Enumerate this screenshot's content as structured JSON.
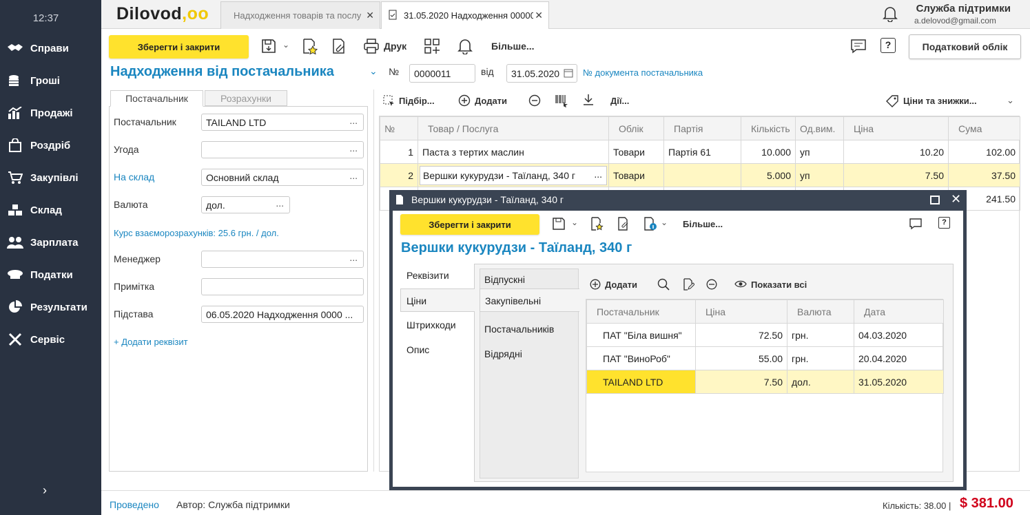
{
  "sidebar": {
    "time": "12:37",
    "items": [
      {
        "label": "Справи",
        "icon": "handshake-icon"
      },
      {
        "label": "Гроші",
        "icon": "coins-icon"
      },
      {
        "label": "Продажі",
        "icon": "chart-icon"
      },
      {
        "label": "Роздріб",
        "icon": "shopping-bag-icon"
      },
      {
        "label": "Закупівлі",
        "icon": "cart-icon"
      },
      {
        "label": "Склад",
        "icon": "boxes-icon"
      },
      {
        "label": "Зарплата",
        "icon": "people-icon"
      },
      {
        "label": "Податки",
        "icon": "officer-cap-icon"
      },
      {
        "label": "Результати",
        "icon": "pie-chart-icon"
      },
      {
        "label": "Сервіс",
        "icon": "tools-icon"
      }
    ],
    "expand": "›"
  },
  "topbar": {
    "logo_text": "Dilovod",
    "logo_accent": ",oo",
    "tabs": [
      {
        "label": "Надходження товарів та послу"
      },
      {
        "label": "31.05.2020 Надходження 00000"
      }
    ],
    "support_name": "Служба підтримки",
    "support_email": "a.delovod@gmail.com"
  },
  "toolbar": {
    "save_close": "Зберегти і закрити",
    "print": "Друк",
    "more": "Більше...",
    "tax": "Податковий облік"
  },
  "doc": {
    "title": "Надходження від постачальника",
    "no_label": "№",
    "number": "0000011",
    "from_label": "від",
    "date": "31.05.2020",
    "supplier_doc_link": "№ документа постачальника"
  },
  "left_panel": {
    "tabs": [
      "Постачальник",
      "Розрахунки"
    ],
    "fields": [
      {
        "label": "Постачальник",
        "value": "TAILAND LTD"
      },
      {
        "label": "Угода",
        "value": ""
      },
      {
        "label": "На склад",
        "value": "Основний склад"
      },
      {
        "label": "Валюта",
        "value": "дол."
      },
      {
        "label": "Менеджер",
        "value": ""
      },
      {
        "label": "Примітка",
        "value": ""
      },
      {
        "label": "Підстава",
        "value": "06.05.2020 Надходження 0000 ..."
      }
    ],
    "rate_text": "Курс взаєморозрахунків: 25.6 грн. / дол.",
    "add_req": "+ Додати реквізит"
  },
  "grid_toolbar": {
    "select": "Підбір...",
    "add": "Додати",
    "actions": "Дії...",
    "prices": "Ціни та знижки..."
  },
  "grid": {
    "headers": [
      "№",
      "Товар / Послуга",
      "Облік",
      "Партія",
      "Кількість",
      "Од.вим.",
      "Ціна",
      "Сума"
    ],
    "rows": [
      [
        "1",
        "Паста з тертих маслин",
        "Товари",
        "Партія 61",
        "10.000",
        "уп",
        "10.20",
        "102.00"
      ],
      [
        "2",
        "Вершки кукурудзи - Таїланд, 340 г",
        "Товари",
        "",
        "5.000",
        "уп",
        "7.50",
        "37.50"
      ]
    ],
    "row3_sum": "241.50"
  },
  "modal": {
    "title": "Вершки кукурудзи - Таїланд, 340 г",
    "save_close": "Зберегти і закрити",
    "more": "Більше...",
    "heading": "Вершки кукурудзи - Таїланд, 340 г",
    "vtabs": [
      "Реквізити",
      "Ціни",
      "Штрихкоди",
      "Опис"
    ],
    "subtabs": [
      "Відпускні",
      "Закупівельні",
      "Постачальників",
      "Відрядні"
    ],
    "add": "Додати",
    "show_all": "Показати всі",
    "headers": [
      "Постачальник",
      "Ціна",
      "Валюта",
      "Дата"
    ],
    "rows": [
      [
        "ПАТ \"Біла вишня\"",
        "72.50",
        "грн.",
        "04.03.2020"
      ],
      [
        "ПАТ \"ВиноРоб\"",
        "55.00",
        "грн.",
        "20.04.2020"
      ],
      [
        "TAILAND LTD",
        "7.50",
        "дол.",
        "31.05.2020"
      ]
    ]
  },
  "footer": {
    "status": "Проведено",
    "author": "Автор: Служба підтримки",
    "qty": "Кількість: 38.00 |",
    "total": "$ 381.00"
  },
  "colors": {
    "sidebar": "#293241",
    "accent": "#ffe22d",
    "link": "#1a86c0",
    "total": "#d0021b"
  }
}
